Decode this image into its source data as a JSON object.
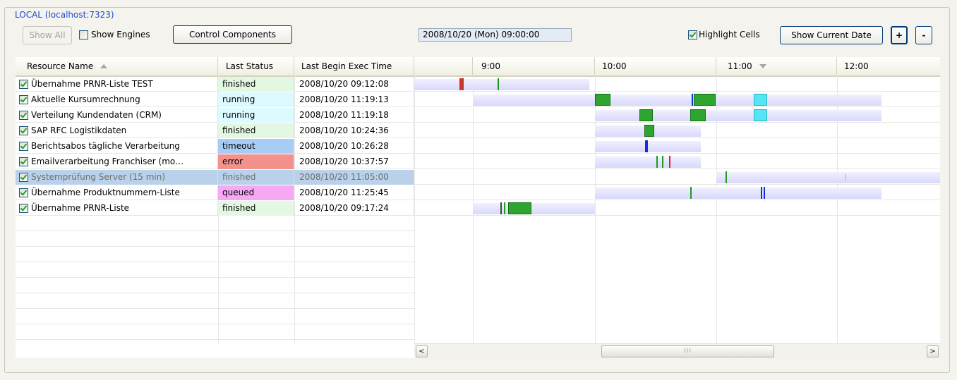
{
  "group": {
    "title": "LOCAL (localhost:7323)"
  },
  "toolbar": {
    "show_all": "Show All",
    "show_engines": "Show Engines",
    "show_engines_checked": false,
    "control_components": "Control Components",
    "current_time": "2008/10/20  (Mon) 09:00:00",
    "highlight_cells": "Highlight Cells",
    "highlight_cells_checked": true,
    "show_current_date": "Show Current Date",
    "zoom_in": "+",
    "zoom_out": "-"
  },
  "table": {
    "headers": {
      "resource_name": "Resource Name",
      "last_status": "Last Status",
      "last_begin_exec_time": "Last Begin Exec Time"
    },
    "timeline_hours": [
      "9:00",
      "10:00",
      "11:00",
      "12:00"
    ],
    "rows": [
      {
        "checked": true,
        "name": "Übernahme PRNR-Liste TEST",
        "status": "finished",
        "time": "2008/10/20 09:12:08"
      },
      {
        "checked": true,
        "name": "Aktuelle Kursumrechnung",
        "status": "running",
        "time": "2008/10/20 11:19:13"
      },
      {
        "checked": true,
        "name": "Verteilung Kundendaten (CRM)",
        "status": "running",
        "time": "2008/10/20 11:19:18"
      },
      {
        "checked": true,
        "name": "SAP RFC Logistikdaten",
        "status": "finished",
        "time": "2008/10/20 10:24:36"
      },
      {
        "checked": true,
        "name": "Berichtsabos tägliche Verarbeitung",
        "status": "timeout",
        "time": "2008/10/20 10:26:28"
      },
      {
        "checked": true,
        "name": "Emailverarbeitung Franchiser (mo…",
        "status": "error",
        "time": "2008/10/20 10:37:57"
      },
      {
        "checked": true,
        "name": "Systemprüfung Server (15 min)",
        "status": "finished",
        "time": "2008/10/20 11:05:00",
        "selected": true
      },
      {
        "checked": true,
        "name": "Übernahme Produktnummern-Liste",
        "status": "queued",
        "time": "2008/10/20 11:25:45"
      },
      {
        "checked": true,
        "name": "Übernahme PRNR-Liste",
        "status": "finished",
        "time": "2008/10/20 09:17:24"
      }
    ]
  },
  "status_colors": {
    "finished": "#e2f8e2",
    "running": "#dcfaff",
    "timeout": "#a8cdf5",
    "error": "#f3918d",
    "queued": "#f6a8f4"
  },
  "scrollbar": {
    "left_arrow": "<",
    "right_arrow": ">",
    "thumb_grip": "III"
  }
}
